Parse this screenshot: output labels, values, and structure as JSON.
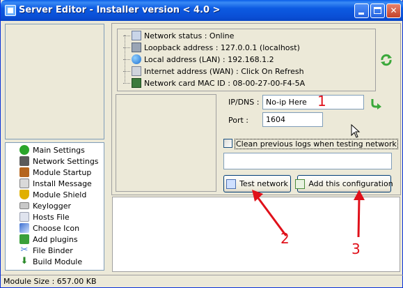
{
  "window": {
    "title": "Server Editor - Installer version < 4.0 >",
    "controls": [
      "minimize-icon",
      "maximize-icon",
      "close-icon"
    ]
  },
  "sidebar": {
    "items": [
      {
        "label": "Main Settings",
        "icon": "main-settings-icon",
        "color": "#2aa52a"
      },
      {
        "label": "Network Settings",
        "icon": "network-settings-icon",
        "color": "#5a5a5a"
      },
      {
        "label": "Module Startup",
        "icon": "module-startup-icon",
        "color": "#b5651d"
      },
      {
        "label": "Install Message",
        "icon": "install-message-icon",
        "color": "#7f7f7f"
      },
      {
        "label": "Module Shield",
        "icon": "module-shield-icon",
        "color": "#e0b000"
      },
      {
        "label": "Keylogger",
        "icon": "keyboard-icon",
        "color": "#808080"
      },
      {
        "label": "Hosts File",
        "icon": "hosts-file-icon",
        "color": "#9aa0b0"
      },
      {
        "label": "Choose Icon",
        "icon": "choose-icon-icon",
        "color": "#3c6fd0"
      },
      {
        "label": "Add plugins",
        "icon": "plugin-icon",
        "color": "#3aa03a"
      },
      {
        "label": "File Binder",
        "icon": "file-binder-icon",
        "color": "#3c78d8"
      },
      {
        "label": "Build Module",
        "icon": "build-module-icon",
        "color": "#2a8a2a"
      }
    ]
  },
  "network_info": {
    "rows": [
      {
        "text": "Network status : Online",
        "icon": "network-status-icon"
      },
      {
        "text": "Loopback address : 127.0.0.1 (localhost)",
        "icon": "loopback-icon"
      },
      {
        "text": "Local address (LAN) : 192.168.1.2",
        "icon": "globe-icon"
      },
      {
        "text": "Internet address (WAN) : Click On Refresh",
        "icon": "wan-icon"
      },
      {
        "text": "Network card MAC ID : 08-00-27-00-F4-5A",
        "icon": "network-card-icon"
      }
    ]
  },
  "form": {
    "ip_label": "IP/DNS :",
    "ip_value": "No-ip Here",
    "port_label": "Port :",
    "port_value": "1604",
    "clean_logs_label": "Clean previous logs when testing network",
    "clean_logs_checked": false,
    "status_field_value": ""
  },
  "buttons": {
    "test_network": "Test network",
    "add_configuration": "Add this configuration"
  },
  "annotations": {
    "one": "1",
    "two": "2",
    "three": "3",
    "color": "#e0101a"
  },
  "status_bar": {
    "text": "Module Size : 657.00 KB"
  }
}
